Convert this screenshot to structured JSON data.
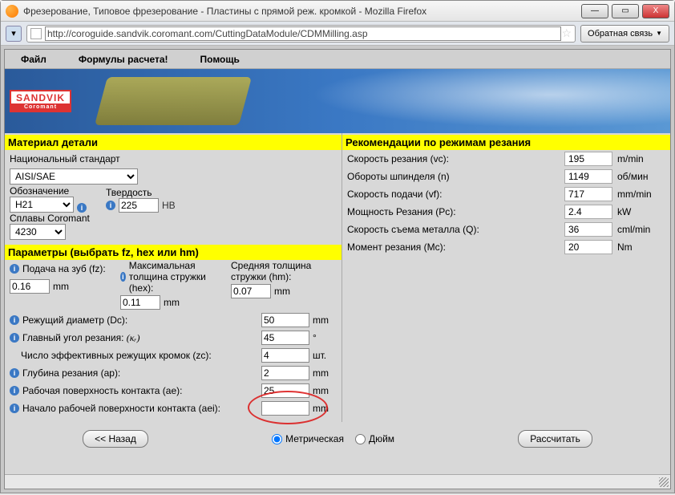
{
  "window": {
    "title": "Фрезерование, Типовое фрезерование - Пластины с прямой реж. кромкой - Mozilla Firefox",
    "min_label": "—",
    "max_label": "▭",
    "close_label": "X"
  },
  "address": {
    "url": "http://coroguide.sandvik.coromant.com/CuttingDataModule/CDMMilling.asp",
    "feedback": "Обратная связь"
  },
  "menu": {
    "file": "Файл",
    "formulas": "Формулы расчета!",
    "help": "Помощь"
  },
  "brand": {
    "name": "SANDVIK",
    "sub": "Coromant"
  },
  "material": {
    "header": "Материал детали",
    "standard_label": "Национальный стандарт",
    "standard_value": "AISI/SAE",
    "designation_label": "Обозначение",
    "designation_value": "H21",
    "hardness_label": "Твердость",
    "hardness_value": "225",
    "hardness_unit": "HB",
    "alloys_label": "Сплавы Coromant",
    "alloys_value": "4230"
  },
  "params": {
    "header": "Параметры (выбрать fz, hex или hm)",
    "fz_label": "Подача на зуб (fz):",
    "fz_value": "0.16",
    "hex_label": "Максимальная толщина стружки (hex):",
    "hex_value": "0.11",
    "hm_label": "Средняя толщина стружки (hm):",
    "hm_value": "0.07",
    "unit_mm": "mm",
    "dc_label": "Режущий диаметр (Dc):",
    "dc_value": "50",
    "kappa_label": "Главный угол резания:",
    "kappa_sym": "(κᵣ)",
    "kappa_value": "45",
    "kappa_unit": "°",
    "zc_label": "Число эффективных режущих кромок (zc):",
    "zc_value": "4",
    "zc_unit": "шт.",
    "ap_label": "Глубина резания (ap):",
    "ap_value": "2",
    "ae_label": "Рабочая поверхность контакта (ae):",
    "ae_value": "25",
    "aei_label": "Начало рабочей поверхности контакта (aei):",
    "aei_value": ""
  },
  "results": {
    "header": "Рекомендации по режимам резания",
    "vc_label": "Скорость резания (vc):",
    "vc_value": "195",
    "vc_unit": "m/min",
    "n_label": "Обороты шпинделя (n)",
    "n_value": "1149",
    "n_unit": "об/мин",
    "vf_label": "Скорость подачи (vf):",
    "vf_value": "717",
    "vf_unit": "mm/min",
    "pc_label": "Мощность Резания (Pc):",
    "pc_value": "2.4",
    "pc_unit": "kW",
    "q_label": "Скорость съема металла (Q):",
    "q_value": "36",
    "q_unit": "cml/min",
    "mc_label": "Момент резания (Mc):",
    "mc_value": "20",
    "mc_unit": "Nm"
  },
  "controls": {
    "back": "<< Назад",
    "metric": "Метрическая",
    "inch": "Дюйм",
    "calculate": "Рассчитать"
  }
}
